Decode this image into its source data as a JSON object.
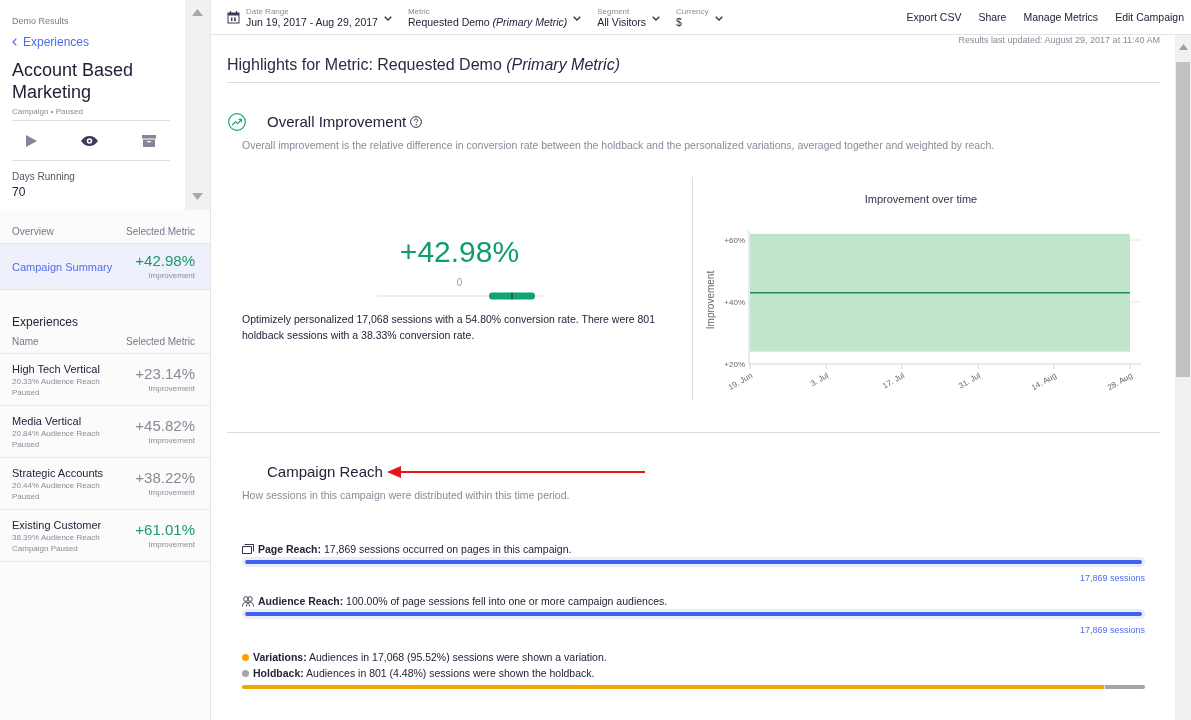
{
  "sidebar": {
    "breadcrumb": "Demo Results",
    "back_link": "Experiences",
    "title": "Account Based Marketing",
    "subtitle": "Campaign • Paused",
    "days_running": {
      "label": "Days Running",
      "value": "70"
    }
  },
  "overview": {
    "columns": [
      "Overview",
      "Selected Metric"
    ],
    "items": [
      {
        "label": "Campaign Summary",
        "value": "+42.98%",
        "caption": "Improvement",
        "selected": true
      }
    ]
  },
  "experiences": {
    "heading": "Experiences",
    "columns": [
      "Name",
      "Selected Metric"
    ],
    "rows": [
      {
        "name": "High Tech Vertical",
        "reach": "20.33% Audience Reach",
        "status": "Paused",
        "value": "+23.14%",
        "caption": "Improvement",
        "color": "#8a8a96",
        "selected": false
      },
      {
        "name": "Media Vertical",
        "reach": "20.84% Audience Reach",
        "status": "Paused",
        "value": "+45.82%",
        "caption": "Improvement",
        "color": "#8a8a96",
        "selected": false
      },
      {
        "name": "Strategic Accounts",
        "reach": "20.44% Audience Reach",
        "status": "Paused",
        "value": "+38.22%",
        "caption": "Improvement",
        "color": "#8a8a96",
        "selected": false
      },
      {
        "name": "Existing Customer",
        "reach": "38.39% Audience Reach",
        "status": "Campaign Paused",
        "value": "+61.01%",
        "caption": "Improvement",
        "color": "#1a9a6c",
        "selected": false
      }
    ]
  },
  "toolbar": {
    "filters": [
      {
        "kind": "date",
        "label": "Date Range",
        "value": "Jun 19, 2017 - Aug 29, 2017"
      },
      {
        "kind": "select",
        "label": "Metric",
        "value": "Requested Demo *(Primary Metric)*"
      },
      {
        "kind": "select",
        "label": "Segment",
        "value": "All Visitors"
      },
      {
        "kind": "select",
        "label": "Currency",
        "value": "$"
      }
    ],
    "actions": [
      "Export CSV",
      "Share",
      "Manage Metrics",
      "Edit Campaign"
    ]
  },
  "last_updated": "Results last updated: August 29, 2017 at 11:40 AM",
  "highlights_title": "Highlights for Metric: Requested Demo *(Primary Metric)*",
  "overall_improvement": {
    "title": "Overall Improvement",
    "description": "Overall improvement is the relative difference in conversion rate between the holdback and the personalized variations, averaged together and weighted by reach.",
    "value": "+42.98%",
    "scale_zero": "0",
    "summary": "Optimizely personalized 17,068 sessions with a 54.80% conversion rate. There were 801 holdback sessions with a 38.33% conversion rate.",
    "chart_data": {
      "type": "line",
      "title": "Improvement over time",
      "ylabel": "Improvement",
      "categories": [
        "19. Jun",
        "3. Jul",
        "17. Jul",
        "31. Jul",
        "14. Aug",
        "28. Aug"
      ],
      "series": [
        {
          "color": "#1f8e46",
          "values": [
            43,
            43,
            43,
            43,
            43,
            43
          ]
        }
      ],
      "bands": [
        {
          "axis": "y",
          "from": 24,
          "to": 62,
          "color": "#c0e4cc"
        }
      ],
      "ylim": [
        20,
        63
      ],
      "yticks": [
        {
          "value": 20,
          "label": "+20%"
        },
        {
          "value": 40,
          "label": "+40%"
        },
        {
          "value": 60,
          "label": "+60%"
        }
      ]
    }
  },
  "campaign_reach": {
    "title": "Campaign Reach",
    "description": "How sessions in this campaign were distributed within this time period.",
    "metrics": [
      {
        "kind": "page",
        "text": "**Page Reach:** 17,869 sessions occurred on pages in this campaign.",
        "level": 1,
        "sessions": "17,869 sessions"
      },
      {
        "kind": "audience",
        "text": "**Audience Reach:** 100.00% of page sessions fell into one or more campaign audiences.",
        "level": 1,
        "sessions": "17,869 sessions"
      }
    ],
    "split": [
      {
        "text": "**Variations:** Audiences in 17,068 (95.52%) sessions were shown a variation.",
        "color": "#f5a500",
        "level": 0.9552
      },
      {
        "text": "**Holdback:** Audiences in 801 (4.48%) sessions were shown the holdback.",
        "color": "#a6a6a6",
        "level": 0.0448
      }
    ]
  }
}
